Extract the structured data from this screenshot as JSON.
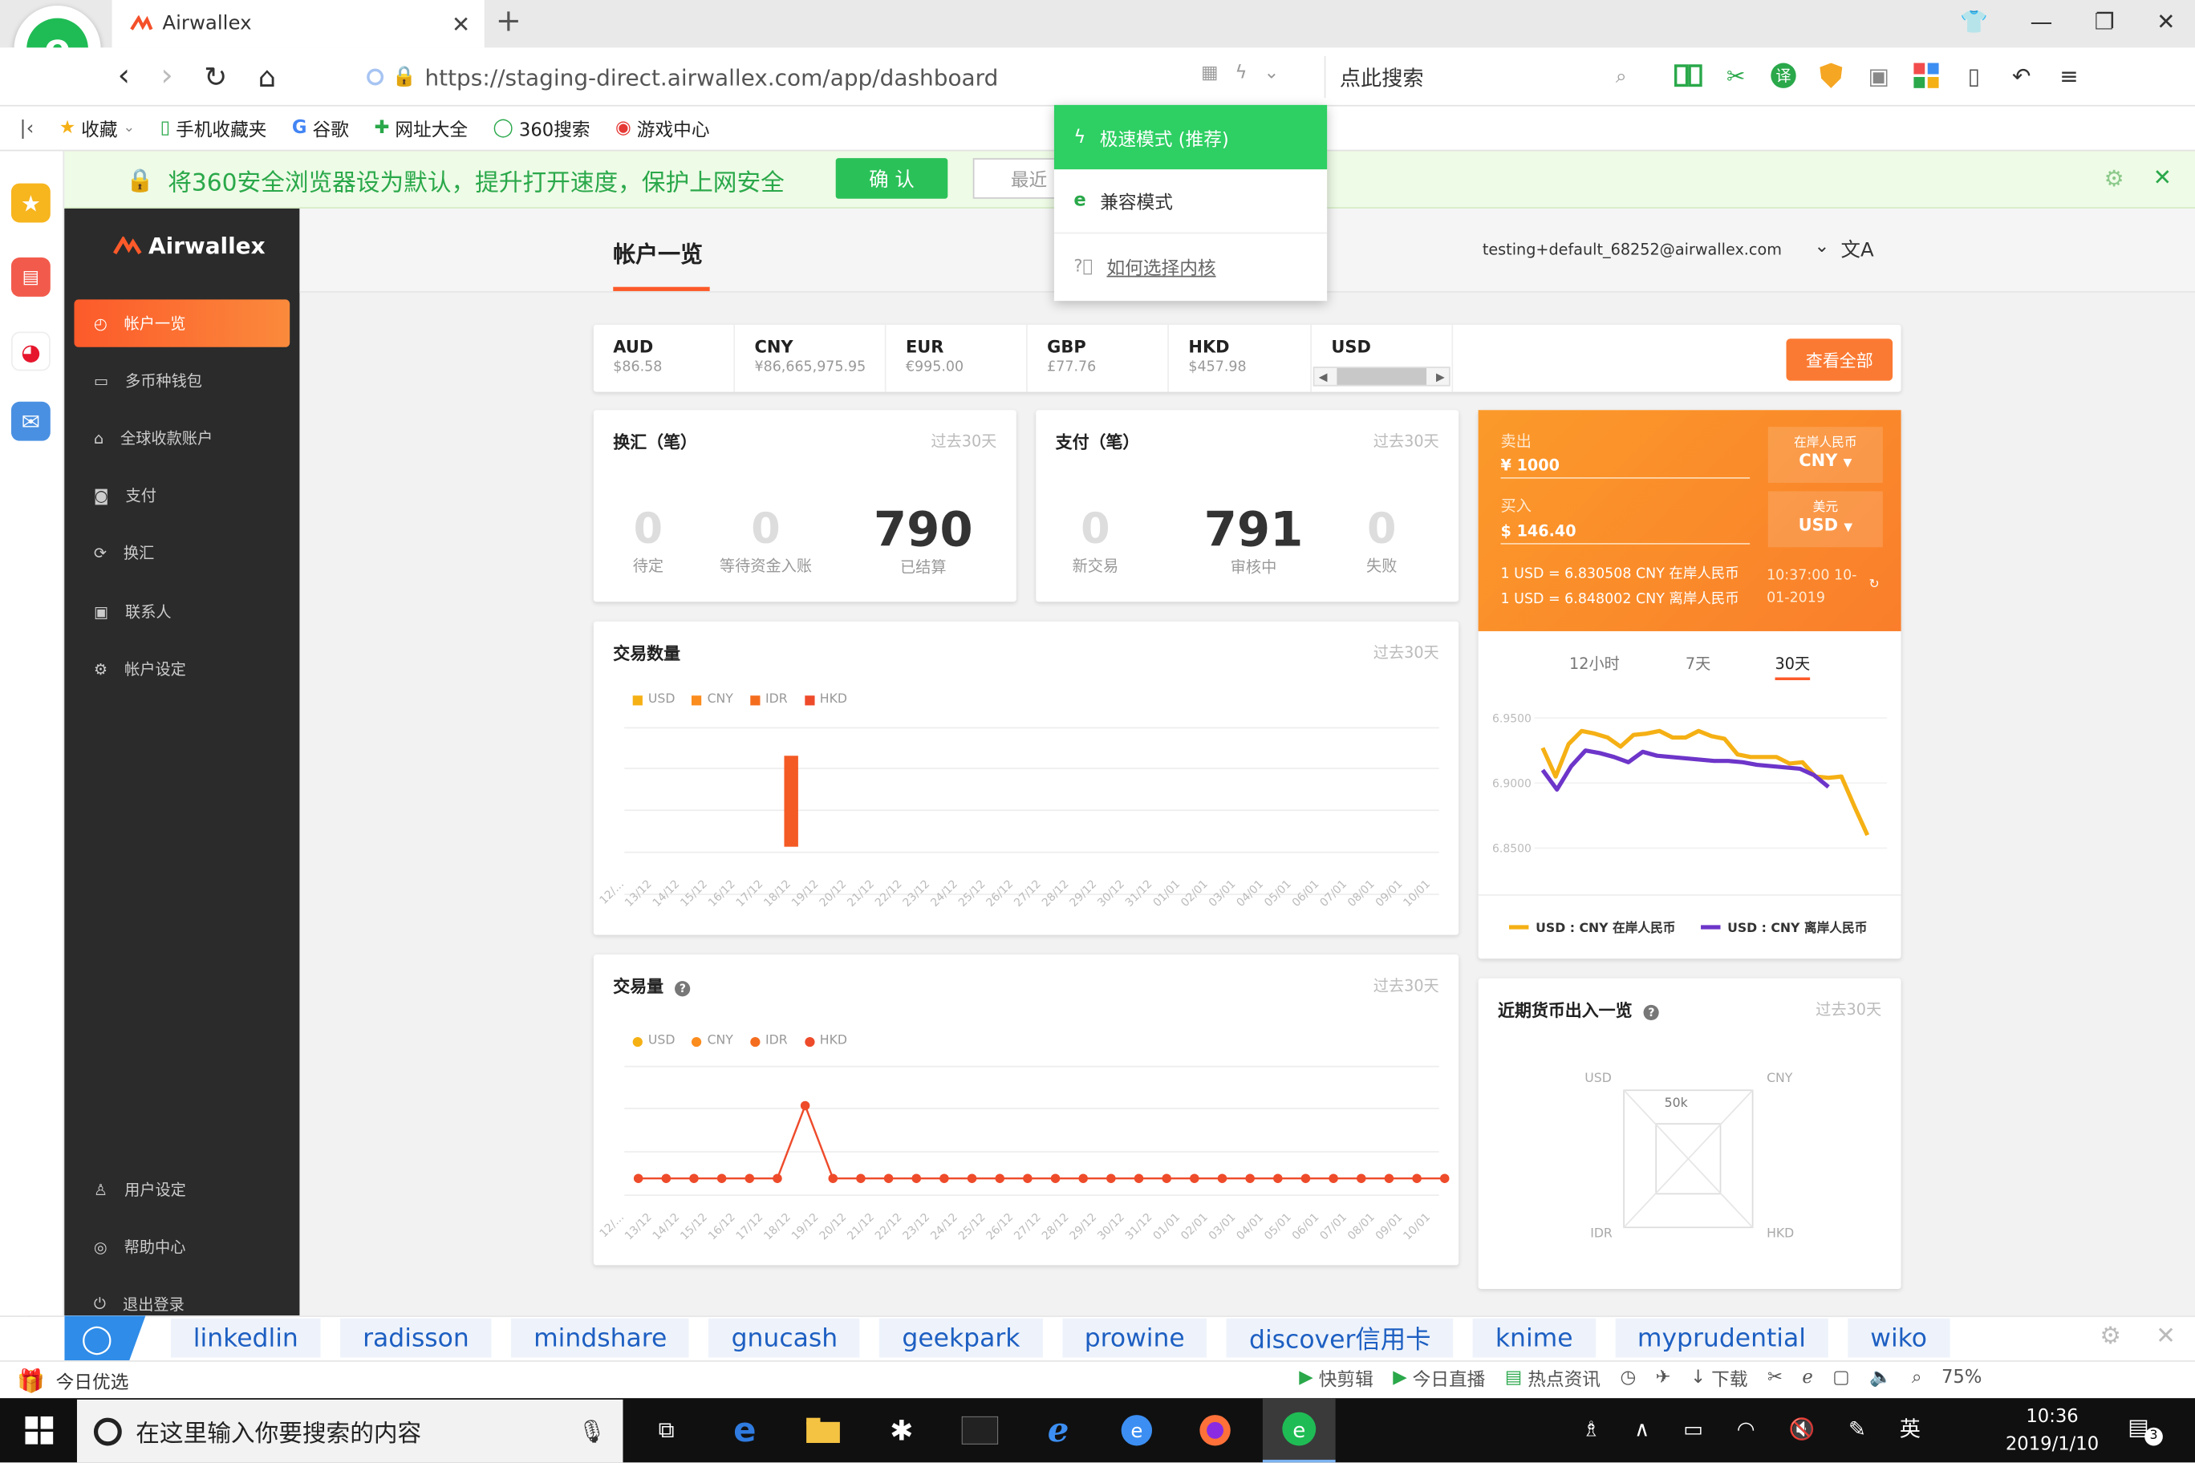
{
  "browser": {
    "tab_title": "Airwallex",
    "url": "https://staging-direct.airwallex.com/app/dashboard",
    "search_placeholder": "点此搜索",
    "bookmarks": [
      "收藏",
      "手机收藏夹",
      "谷歌",
      "网址大全",
      "360搜索",
      "游戏中心"
    ],
    "notice": "将360安全浏览器设为默认，提升打开速度，保护上网安全",
    "confirm_label": "确 认",
    "recent_label": "最近",
    "kernel_menu": [
      "极速模式 (推荐)",
      "兼容模式",
      "如何选择内核"
    ]
  },
  "app": {
    "brand": "Airwallex",
    "nav": [
      "帐户一览",
      "多币种钱包",
      "全球收款账户",
      "支付",
      "换汇",
      "联系人",
      "帐户设定"
    ],
    "nav_bottom": [
      "用户设定",
      "帮助中心",
      "退出登录"
    ],
    "page_title": "帐户一览",
    "user_email": "testing+default_68252@airwallex.com",
    "balances": [
      {
        "code": "AUD",
        "amount": "$86.58"
      },
      {
        "code": "CNY",
        "amount": "¥86,665,975.95"
      },
      {
        "code": "EUR",
        "amount": "€995.00"
      },
      {
        "code": "GBP",
        "amount": "£77.76"
      },
      {
        "code": "HKD",
        "amount": "$457.98"
      },
      {
        "code": "USD",
        "amount": ""
      }
    ],
    "view_all": "查看全部",
    "exchange": {
      "title": "换汇（笔）",
      "period": "过去30天",
      "stats": [
        {
          "v": "0",
          "l": "待定"
        },
        {
          "v": "0",
          "l": "等待资金入账"
        },
        {
          "v": "790",
          "l": "已结算"
        }
      ]
    },
    "payment": {
      "title": "支付（笔）",
      "period": "过去30天",
      "stats": [
        {
          "v": "0",
          "l": "新交易"
        },
        {
          "v": "791",
          "l": "审核中"
        },
        {
          "v": "0",
          "l": "失败"
        }
      ]
    },
    "fx": {
      "sell_label": "卖出",
      "sell_value": "¥ 1000",
      "sell_ccy_name": "在岸人民币",
      "sell_ccy": "CNY",
      "buy_label": "买入",
      "buy_value": "$ 146.40",
      "buy_ccy_name": "美元",
      "buy_ccy": "USD",
      "rate1": "1 USD = 6.830508 CNY 在岸人民币",
      "rate2": "1 USD = 6.848002 CNY 离岸人民币",
      "time": "10:37:00 10-01-2019",
      "tabs": [
        "12小时",
        "7天",
        "30天"
      ],
      "yticks": [
        "6.9500",
        "6.9000",
        "6.8500"
      ],
      "legend": [
        "USD : CNY 在岸人民币",
        "USD : CNY 离岸人民币"
      ]
    },
    "tx_count": {
      "title": "交易数量",
      "period": "过去30天",
      "legend": [
        "USD",
        "CNY",
        "IDR",
        "HKD"
      ]
    },
    "tx_volume": {
      "title": "交易量",
      "period": "过去30天",
      "legend": [
        "USD",
        "CNY",
        "IDR",
        "HKD"
      ]
    },
    "recent_flow": {
      "title": "近期货币出入一览",
      "period": "过去30天",
      "axes": [
        "USD",
        "CNY",
        "IDR",
        "HKD"
      ],
      "scale": "50k"
    },
    "xdates": [
      "12/...",
      "13/12",
      "14/12",
      "15/12",
      "16/12",
      "17/12",
      "18/12",
      "19/12",
      "20/12",
      "21/12",
      "22/12",
      "23/12",
      "24/12",
      "25/12",
      "26/12",
      "27/12",
      "28/12",
      "29/12",
      "30/12",
      "31/12",
      "01/01",
      "02/01",
      "03/01",
      "04/01",
      "05/01",
      "06/01",
      "07/01",
      "08/01",
      "09/01",
      "10/01"
    ]
  },
  "quicklinks": [
    "linkedlin",
    "radisson",
    "mindshare",
    "gnucash",
    "geekpark",
    "prowine",
    "discover信用卡",
    "knime",
    "myprudential",
    "wiko"
  ],
  "statusbar": {
    "left": "今日优选",
    "items": [
      "快剪辑",
      "今日直播",
      "热点资讯",
      "下载"
    ],
    "zoom": "75%"
  },
  "taskbar": {
    "search": "在这里输入你要搜索的内容",
    "time": "10:36",
    "date": "2019/1/10",
    "ime": "英",
    "notif": "3"
  },
  "chart_data": [
    {
      "type": "bar",
      "title": "交易数量",
      "categories": [
        "12/...",
        "13/12",
        "14/12",
        "15/12",
        "16/12",
        "17/12",
        "18/12",
        "19/12",
        "20/12",
        "21/12",
        "22/12",
        "23/12",
        "24/12",
        "25/12",
        "26/12",
        "27/12",
        "28/12",
        "29/12",
        "30/12",
        "31/12",
        "01/01",
        "02/01",
        "03/01",
        "04/01",
        "05/01",
        "06/01",
        "07/01",
        "08/01",
        "09/01",
        "10/01"
      ],
      "series": [
        {
          "name": "CNY",
          "values": [
            0,
            0,
            0,
            0,
            0,
            0,
            1,
            0,
            0,
            0,
            0,
            0,
            0,
            0,
            0,
            0,
            0,
            0,
            0,
            0,
            0,
            0,
            0,
            0,
            0,
            0,
            0,
            0,
            0,
            0
          ]
        }
      ]
    },
    {
      "type": "line",
      "title": "交易量",
      "categories": [
        "12/...",
        "13/12",
        "14/12",
        "15/12",
        "16/12",
        "17/12",
        "18/12",
        "19/12",
        "20/12",
        "21/12",
        "22/12",
        "23/12",
        "24/12",
        "25/12",
        "26/12",
        "27/12",
        "28/12",
        "29/12",
        "30/12",
        "31/12",
        "01/01",
        "02/01",
        "03/01",
        "04/01",
        "05/01",
        "06/01",
        "07/01",
        "08/01",
        "09/01",
        "10/01"
      ],
      "series": [
        {
          "name": "HKD",
          "values": [
            0,
            0,
            0,
            0,
            0,
            0,
            1,
            0,
            0,
            0,
            0,
            0,
            0,
            0,
            0,
            0,
            0,
            0,
            0,
            0,
            0,
            0,
            0,
            0,
            0,
            0,
            0,
            0,
            0,
            0
          ]
        }
      ]
    },
    {
      "type": "line",
      "ylim": [
        6.85,
        6.95
      ],
      "series": [
        {
          "name": "USD : CNY 在岸人民币",
          "color": "#f5b014",
          "values": [
            6.927,
            6.905,
            6.93,
            6.94,
            6.938,
            6.935,
            6.928,
            6.937,
            6.938,
            6.94,
            6.935,
            6.935,
            6.94,
            6.936,
            6.934,
            6.922,
            6.92,
            6.92,
            6.92,
            6.915,
            6.916,
            6.905,
            6.904,
            6.905,
            6.882,
            6.86
          ]
        },
        {
          "name": "USD : CNY 离岸人民币",
          "color": "#6d35c9",
          "values": [
            6.91,
            6.895,
            6.913,
            6.925,
            6.923,
            6.92,
            6.916,
            6.924,
            6.921,
            6.92,
            6.919,
            6.918,
            6.917,
            6.917,
            6.916,
            6.914,
            6.913,
            6.912,
            6.911,
            6.906,
            6.897
          ]
        }
      ]
    }
  ]
}
